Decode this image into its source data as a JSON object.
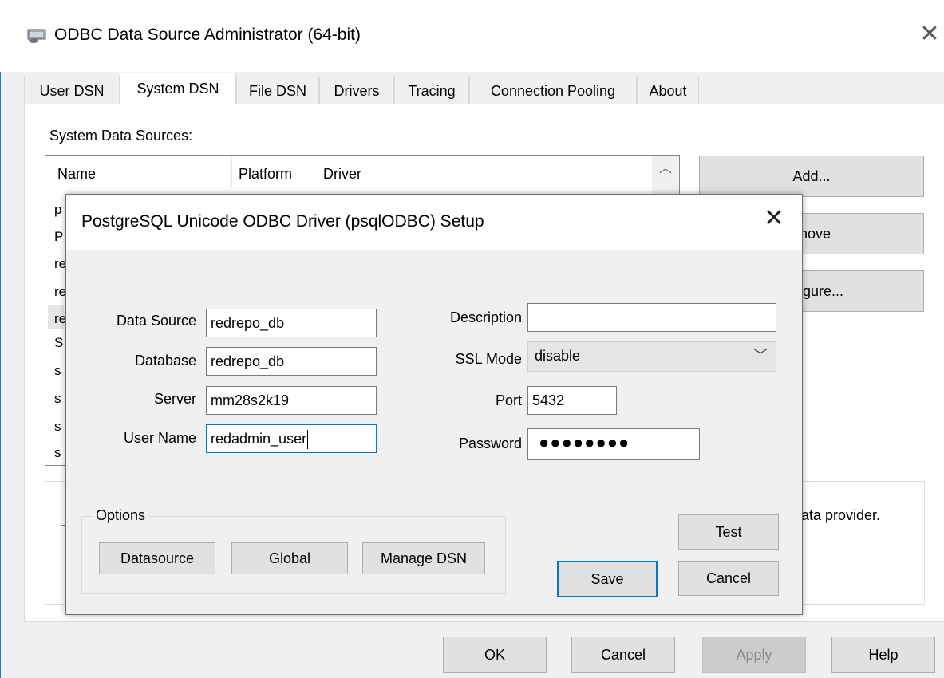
{
  "window": {
    "title": "ODBC Data Source Administrator (64-bit)",
    "close_glyph": "✕"
  },
  "tabs": [
    {
      "label": "User DSN"
    },
    {
      "label": "System DSN"
    },
    {
      "label": "File DSN"
    },
    {
      "label": "Drivers"
    },
    {
      "label": "Tracing"
    },
    {
      "label": "Connection Pooling"
    },
    {
      "label": "About"
    }
  ],
  "active_tab": "System DSN",
  "system_dsn": {
    "list_label": "System Data Sources:",
    "columns": {
      "name": "Name",
      "platform": "Platform",
      "driver": "Driver"
    },
    "row_stubs": [
      "p",
      "P",
      "re",
      "re",
      "re",
      "S",
      "s",
      "s",
      "s",
      "s"
    ],
    "buttons": {
      "add": "Add...",
      "remove": "move",
      "configure": "figure..."
    },
    "info_text": "lata provider."
  },
  "footer": {
    "ok": "OK",
    "cancel": "Cancel",
    "apply": "Apply",
    "help": "Help"
  },
  "dialog": {
    "title": "PostgreSQL Unicode ODBC Driver (psqlODBC) Setup",
    "close_glyph": "✕",
    "fields": {
      "data_source": {
        "label": "Data Source",
        "value": "redrepo_db"
      },
      "database": {
        "label": "Database",
        "value": "redrepo_db"
      },
      "server": {
        "label": "Server",
        "value": "mm28s2k19"
      },
      "user_name": {
        "label": "User Name",
        "value": "redadmin_user"
      },
      "description": {
        "label": "Description",
        "value": ""
      },
      "ssl_mode": {
        "label": "SSL Mode",
        "value": "disable"
      },
      "port": {
        "label": "Port",
        "value": "5432"
      },
      "password": {
        "label": "Password",
        "masked": "●●●●●●●●"
      }
    },
    "options": {
      "label": "Options",
      "datasource": "Datasource",
      "global": "Global",
      "manage_dsn": "Manage DSN"
    },
    "buttons": {
      "test": "Test",
      "save": "Save",
      "cancel": "Cancel"
    }
  },
  "colors": {
    "accent": "#0078d7",
    "window_border": "#1f7ad3"
  }
}
